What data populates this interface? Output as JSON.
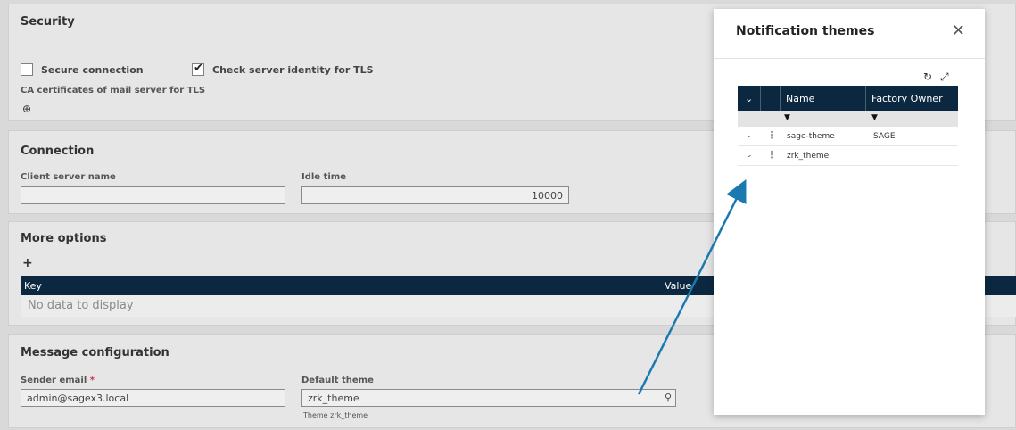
{
  "security": {
    "title": "Security",
    "secure_connection_label": "Secure connection",
    "check_server_identity_label": "Check server identity for TLS",
    "ca_certificates_label": "CA certificates of mail server for TLS"
  },
  "connection": {
    "title": "Connection",
    "client_server_name_label": "Client server name",
    "client_server_name_value": "",
    "idle_time_label": "Idle time",
    "idle_time_value": "10000"
  },
  "more_options": {
    "title": "More options",
    "add_label": "+",
    "columns": [
      "Key",
      "Value"
    ],
    "empty_text": "No data to display"
  },
  "message": {
    "title": "Message configuration",
    "sender_email_label": "Sender email",
    "required_marker": "*",
    "sender_email_value": "admin@sagex3.local",
    "default_theme_label": "Default theme",
    "default_theme_value": "zrk_theme",
    "default_theme_hint": "Theme zrk_theme"
  },
  "modal": {
    "title": "Notification themes",
    "close": "✕",
    "columns": [
      "Name",
      "Factory Owner"
    ],
    "rows": [
      {
        "name": "sage-theme",
        "owner": "SAGE"
      },
      {
        "name": "zrk_theme",
        "owner": ""
      }
    ]
  },
  "colors": {
    "header_dark": "#0c2840",
    "arrow": "#1a7ab0",
    "required": "#c7384f"
  }
}
